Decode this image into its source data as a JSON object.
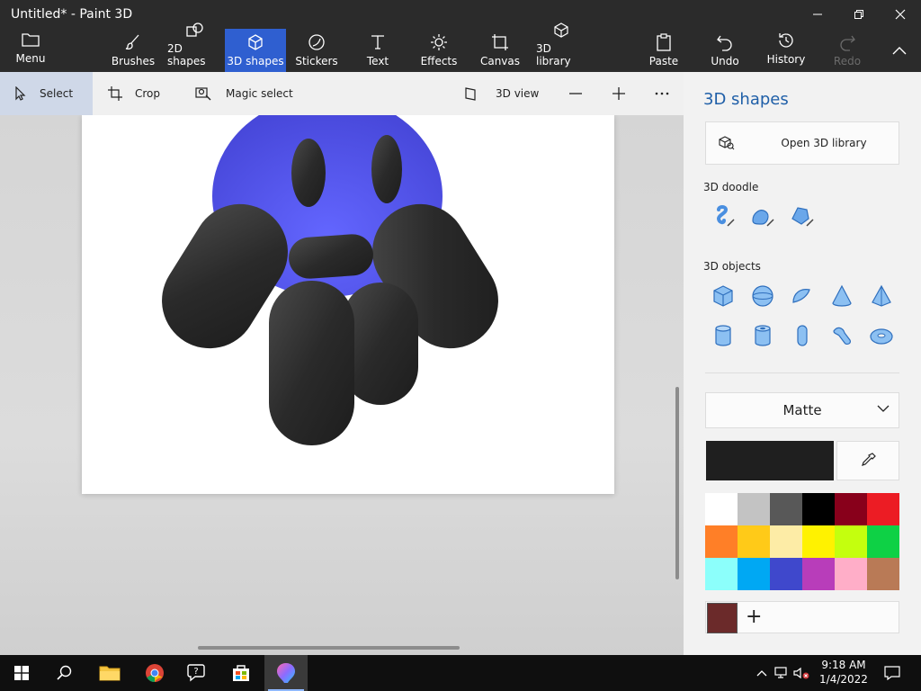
{
  "window": {
    "title": "Untitled* - Paint 3D"
  },
  "ribbon": {
    "menu": "Menu",
    "brushes": "Brushes",
    "shapes2d": "2D shapes",
    "shapes3d": "3D shapes",
    "stickers": "Stickers",
    "text": "Text",
    "effects": "Effects",
    "canvas": "Canvas",
    "library3d": "3D library",
    "paste": "Paste",
    "undo": "Undo",
    "history": "History",
    "redo": "Redo"
  },
  "toolbar": {
    "select": "Select",
    "crop": "Crop",
    "magic_select": "Magic select",
    "view3d": "3D view"
  },
  "panel": {
    "title": "3D shapes",
    "open_library": "Open 3D library",
    "doodle_label": "3D doodle",
    "objects_label": "3D objects",
    "material": "Matte",
    "current_color": "#1f1f1f",
    "custom_color": "#6b2a2a",
    "palette": [
      "#ffffff",
      "#c3c3c3",
      "#585858",
      "#000000",
      "#88001b",
      "#ec1c24",
      "#ff7f27",
      "#ffca18",
      "#fdeca6",
      "#fff200",
      "#c4ff0e",
      "#0ed145",
      "#8cfffb",
      "#00a8f3",
      "#3f48cc",
      "#b83dba",
      "#ffaec8",
      "#b97a56"
    ]
  },
  "taskbar": {
    "time": "9:18 AM",
    "date": "1/4/2022"
  },
  "colors": {
    "accent": "#2f5fd0",
    "ribbon_bg": "#2b2b2b",
    "blob": "#4c4ee0",
    "pill": "#2a2a2a"
  }
}
